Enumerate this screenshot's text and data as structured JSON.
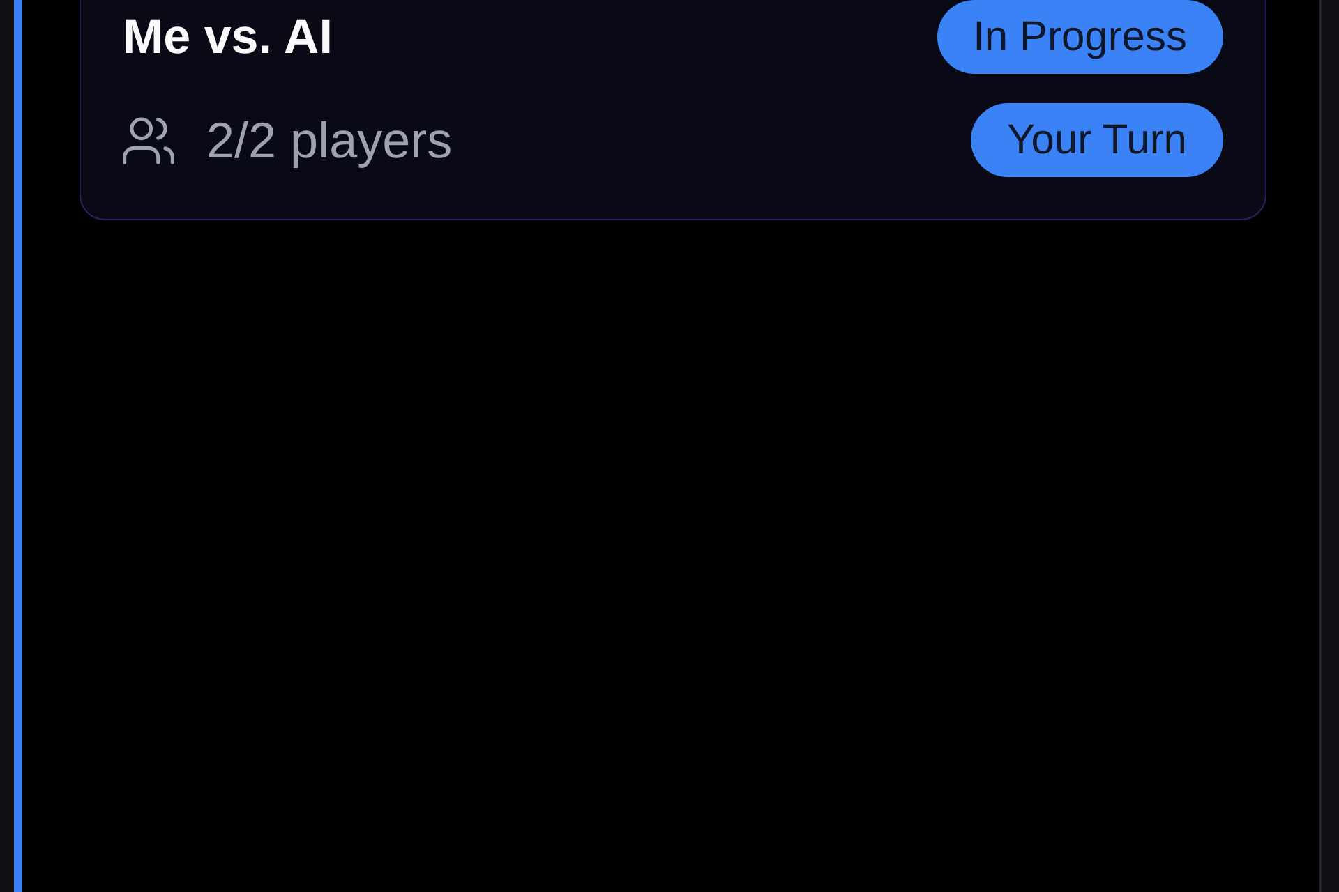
{
  "game_card": {
    "title": "Me vs. AI",
    "players": "2/2 players",
    "badges": [
      {
        "label": "In Progress"
      },
      {
        "label": "Your Turn"
      }
    ]
  }
}
